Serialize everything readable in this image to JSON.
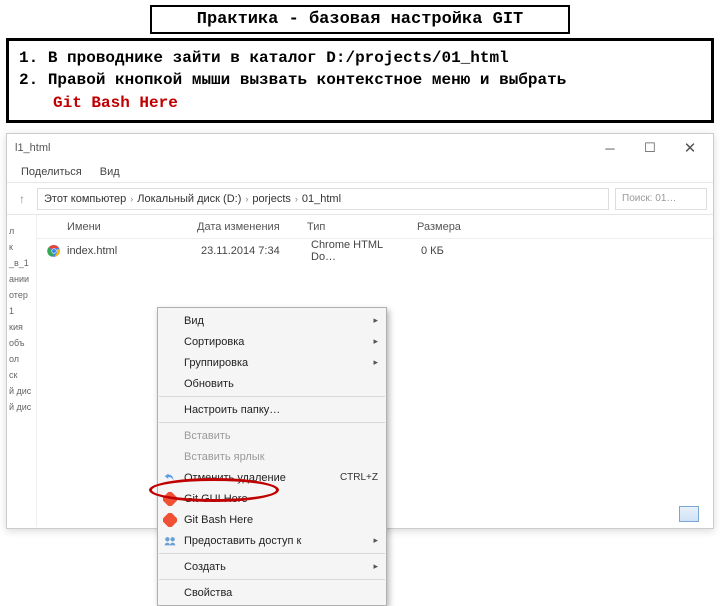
{
  "page_title": "Практика - базовая настройка GIT",
  "instructions": {
    "item1": "В проводнике зайти в каталог D:/projects/01_html",
    "item2": "Правой кнопкой мыши вызвать контекстное меню и выбрать",
    "highlight": "Git Bash Here"
  },
  "explorer": {
    "window_title": "l1_html",
    "menu": {
      "share": "Поделиться",
      "view": "Вид"
    },
    "breadcrumb": {
      "root": "Этот компьютер",
      "drive": "Локальный диск (D:)",
      "folder1": "porjects",
      "folder2": "01_html"
    },
    "search_placeholder": "Поиск: 01…",
    "columns": {
      "name": "Имени",
      "date": "Дата изменения",
      "type": "Тип",
      "size": "Размера"
    },
    "file": {
      "name": "index.html",
      "date": "23.11.2014 7:34",
      "type": "Chrome HTML Do…",
      "size": "0 КБ"
    },
    "sidebar": {
      "i1": "л",
      "i2": "к",
      "i3": "_в_1",
      "i4": "ании",
      "i5": "отер",
      "i6": "1",
      "i7": "кия",
      "i8": "объ",
      "i9": "ол",
      "i10": "ск",
      "i11": "й дис",
      "i12": "й дис"
    },
    "context_menu": {
      "view": "Вид",
      "sort": "Сортировка",
      "group": "Группировка",
      "refresh": "Обновить",
      "customize": "Настроить папку…",
      "paste": "Вставить",
      "paste_shortcut": "Вставить ярлык",
      "undo": "Отменить удаление",
      "undo_key": "CTRL+Z",
      "git_gui": "Git GUI Here",
      "git_bash": "Git Bash Here",
      "share_access": "Предоставить доступ к",
      "create": "Создать",
      "properties": "Свойства"
    }
  }
}
